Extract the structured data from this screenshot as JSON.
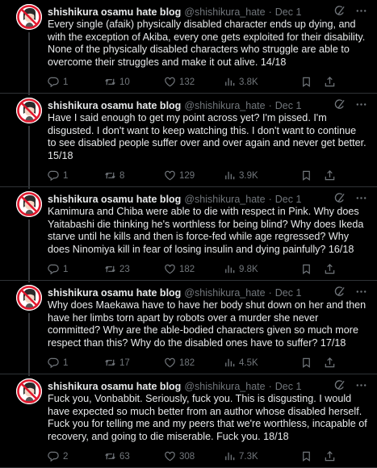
{
  "colors": {
    "background": "#000000",
    "text": "#e7e9ea",
    "muted": "#71767b",
    "divider": "#2f3336"
  },
  "icons": {
    "avatar": "crossed-out-anime-character-avatar",
    "grok": "grok-icon",
    "more": "more-icon",
    "reply": "reply-icon",
    "retweet": "retweet-icon",
    "like": "heart-icon",
    "views": "views-icon",
    "bookmark": "bookmark-icon",
    "share": "share-icon"
  },
  "tweets": [
    {
      "name": "shishikura osamu hate blog",
      "handle": "@shishikura_hate",
      "sep": "·",
      "date": "Dec 1",
      "text": "Every single (afaik) physically disabled character ends up dying, and with the exception of Akiba, every one gets exploited for their disability. None of the physically disabled characters who struggle are able to overcome their struggles and make it out alive. 14/18",
      "replies": "1",
      "retweets": "10",
      "likes": "132",
      "views": "3.8K"
    },
    {
      "name": "shishikura osamu hate blog",
      "handle": "@shishikura_hate",
      "sep": "·",
      "date": "Dec 1",
      "text": "Have I said enough to get my point across yet? I'm pissed. I'm disgusted. I don't want to keep watching this. I don't want to continue to see disabled people suffer over and over again and never get better. 15/18",
      "replies": "1",
      "retweets": "8",
      "likes": "129",
      "views": "3.9K"
    },
    {
      "name": "shishikura osamu hate blog",
      "handle": "@shishikura_hate",
      "sep": "·",
      "date": "Dec 1",
      "text": "Kamimura and Chiba were able to die with respect in Pink. Why does Yaitabashi die thinking he's worthless for being blind? Why does Ikeda starve until he kills and then is force-fed while age regressed? Why does Ninomiya kill in fear of losing insulin and dying painfully? 16/18",
      "replies": "1",
      "retweets": "23",
      "likes": "182",
      "views": "9.8K"
    },
    {
      "name": "shishikura osamu hate blog",
      "handle": "@shishikura_hate",
      "sep": "·",
      "date": "Dec 1",
      "text": "Why does Maekawa have to have her body shut down on her and then have her limbs torn apart by robots over a murder she never committed? Why are the able-bodied characters given so much more respect than this? Why do the disabled ones have to suffer? 17/18",
      "replies": "1",
      "retweets": "17",
      "likes": "182",
      "views": "4.5K"
    },
    {
      "name": "shishikura osamu hate blog",
      "handle": "@shishikura_hate",
      "sep": "·",
      "date": "Dec 1",
      "text": "Fuck you, Vonbabbit. Seriously, fuck you. This is disgusting. I would have expected so much better from an author whose disabled herself. Fuck you for telling me and my peers that we're worthless, incapable of recovery, and going to die miserable. Fuck you. 18/18",
      "replies": "2",
      "retweets": "63",
      "likes": "308",
      "views": "7.3K"
    }
  ]
}
